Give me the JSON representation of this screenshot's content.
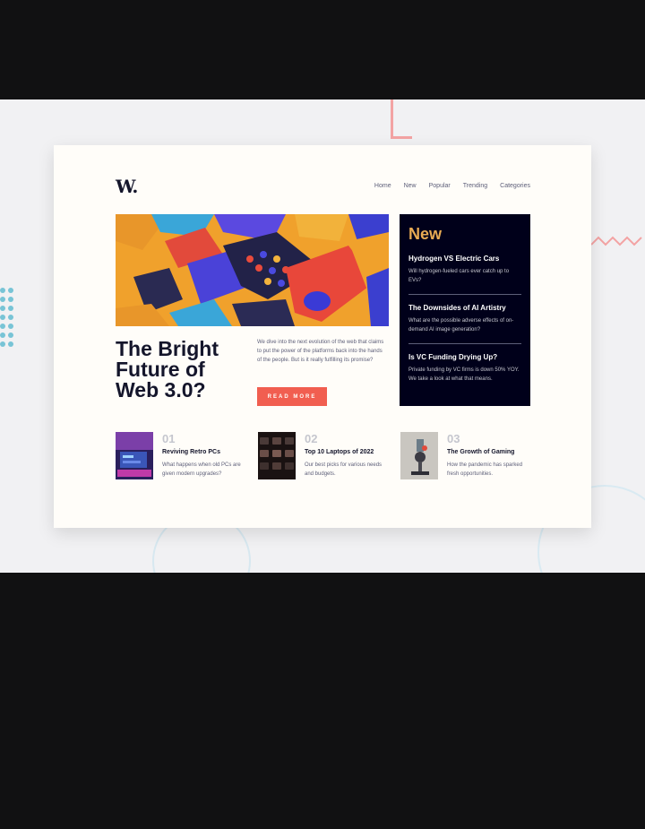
{
  "logo": {
    "text": "W."
  },
  "nav": {
    "items": [
      "Home",
      "New",
      "Popular",
      "Trending",
      "Categories"
    ]
  },
  "hero": {
    "headline": "The Bright Future of Web 3.0?",
    "description": "We dive into the next evolution of the web that claims to put the power of the platforms back into the hands of the people. But is it really fulfilling its promise?",
    "cta": "READ MORE"
  },
  "new_panel": {
    "title": "New",
    "items": [
      {
        "title": "Hydrogen VS Electric Cars",
        "desc": "Will hydrogen-fueled cars ever catch up to EVs?"
      },
      {
        "title": "The Downsides of AI Artistry",
        "desc": "What are the possible adverse effects of on-demand AI image generation?"
      },
      {
        "title": "Is VC Funding Drying Up?",
        "desc": "Private funding by VC firms is down 50% YOY. We take a look at what that means."
      }
    ]
  },
  "articles": [
    {
      "num": "01",
      "title": "Reviving Retro PCs",
      "desc": "What happens when old PCs are given modern upgrades?"
    },
    {
      "num": "02",
      "title": "Top 10 Laptops of 2022",
      "desc": "Our best picks for various needs and budgets."
    },
    {
      "num": "03",
      "title": "The Growth of Gaming",
      "desc": "How the pandemic has sparked fresh opportunities."
    }
  ],
  "colors": {
    "accent": "#f15e50",
    "gold": "#e9ab53",
    "dark": "#00001a",
    "text": "#14152b",
    "muted": "#5d5f79"
  }
}
